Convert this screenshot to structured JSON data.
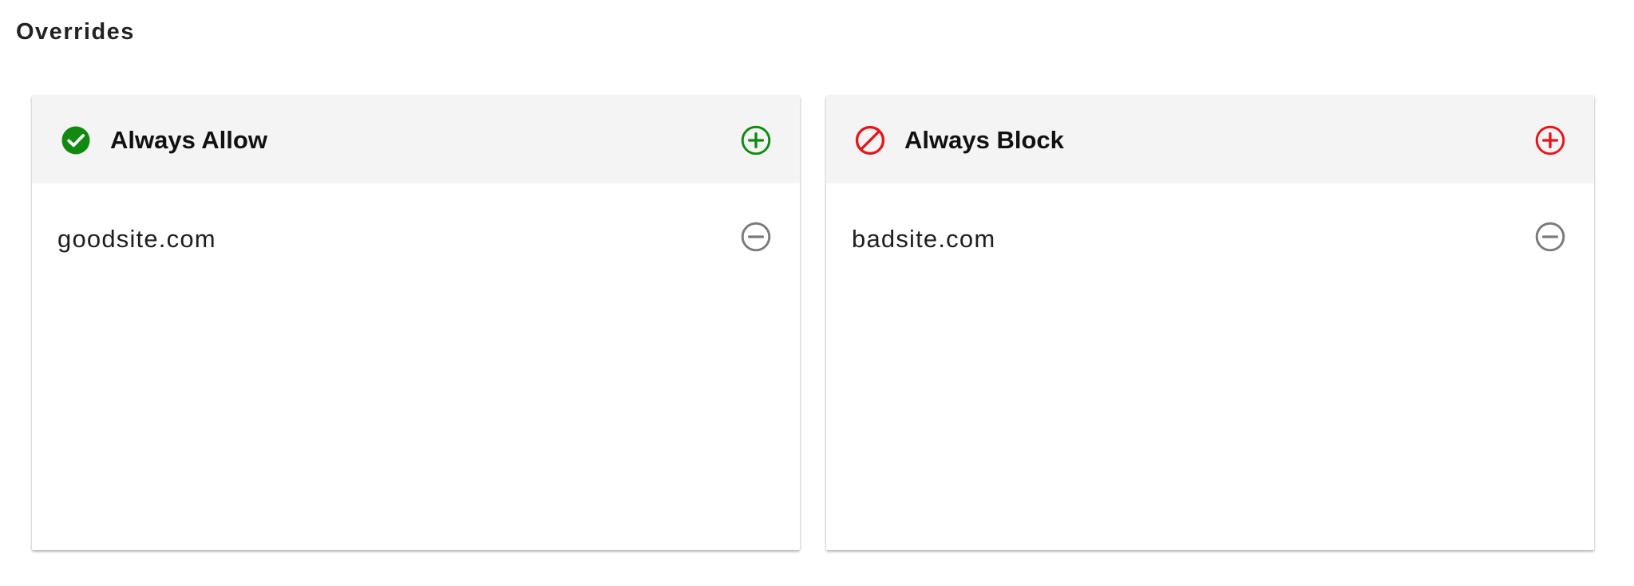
{
  "section": {
    "title": "Overrides"
  },
  "allow_card": {
    "title": "Always Allow",
    "header_icon": "check-circle-icon",
    "add_icon": "plus-circle-icon",
    "accent_color": "#108a10",
    "items": [
      {
        "domain": "goodsite.com",
        "remove_icon": "minus-circle-icon"
      }
    ]
  },
  "block_card": {
    "title": "Always Block",
    "header_icon": "block-icon",
    "add_icon": "plus-circle-icon",
    "accent_color": "#e8141a",
    "items": [
      {
        "domain": "badsite.com",
        "remove_icon": "minus-circle-icon"
      }
    ]
  },
  "colors": {
    "header_bg": "#f4f4f4",
    "remove_icon": "#7a7a7a"
  }
}
